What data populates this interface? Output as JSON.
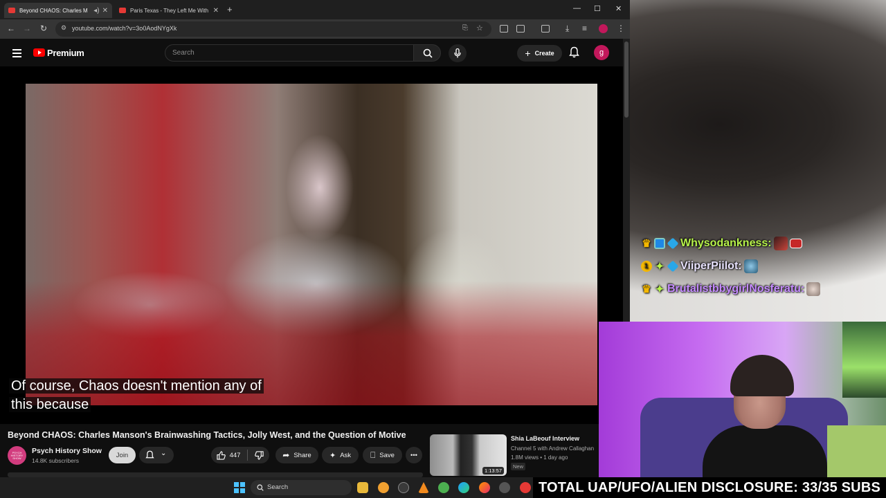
{
  "browser": {
    "tabs": [
      {
        "title": "Beyond CHAOS: Charles M",
        "active": true
      },
      {
        "title": "Paris Texas - They Left Me With",
        "active": false
      }
    ],
    "url": "youtube.com/watch?v=3o0AodNYgXk"
  },
  "youtube": {
    "logo_text": "Premium",
    "search_placeholder": "Search",
    "create_label": "Create",
    "avatar_letter": "g",
    "caption_line1": "Of course, Chaos doesn't mention any of",
    "caption_line2": "this because",
    "video_title": "Beyond CHAOS: Charles Manson's Brainwashing Tactics, Jolly West, and the Question of Motive",
    "channel": {
      "name": "Psych History Show",
      "subscribers": "14.8K subscribers",
      "avatar_text": "PSYCH HISTORY SHOW"
    },
    "join_label": "Join",
    "like_count": "447",
    "share_label": "Share",
    "ask_label": "Ask",
    "save_label": "Save",
    "recommendation": {
      "title": "Shia LaBeouf Interview",
      "channel": "Channel 5 with Andrew Callaghan",
      "meta": "1.8M views • 1 day ago",
      "badge": "New",
      "duration": "1:13:57"
    }
  },
  "chat": [
    {
      "user": "Whysodankness:",
      "color": "#b6f24a"
    },
    {
      "user": "ViiperPiilot:",
      "color": "#e9e3ff"
    },
    {
      "user": "BrutalistbbygirlNosferatu:",
      "color": "#c58bff"
    }
  ],
  "taskbar": {
    "search_label": "Search"
  },
  "stream_banner": "TOTAL UAP/UFO/ALIEN DISCLOSURE: 33/35 SUBS"
}
